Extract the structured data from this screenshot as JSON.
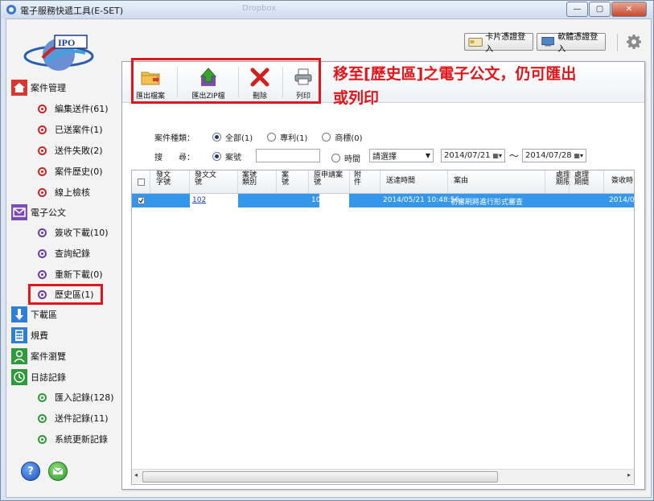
{
  "window": {
    "title": "電子服務快遞工具(E-SET)",
    "background_title": "Dropbox",
    "buttons": {
      "minimize": "—",
      "maximize": "▢",
      "close": "✕"
    }
  },
  "header": {
    "card_login": "卡片憑證登入",
    "software_login": "軟體憑證登入",
    "settings_icon": "gear-icon"
  },
  "sidebar": {
    "case_mgmt": {
      "label": "案件管理",
      "items": [
        "編集送件(61)",
        "已送案件(1)",
        "送件失敗(2)",
        "案件歷史(0)",
        "線上檢核"
      ]
    },
    "e_doc": {
      "label": "電子公文",
      "items": [
        "簽收下載(10)",
        "查詢紀錄",
        "重新下載(0)",
        "歷史區(1)"
      ]
    },
    "download": "下載區",
    "fees": "規費",
    "case_browse": "案件瀏覽",
    "log": {
      "label": "日誌記錄",
      "items": [
        "匯入記錄(128)",
        "送件記錄(11)",
        "系統更新記錄"
      ]
    }
  },
  "toolbar": {
    "export_file": "匯出檔案",
    "export_zip": "匯出ZIP檔",
    "delete": "刪除",
    "print": "列印"
  },
  "annotation": {
    "line1": "移至[歷史區]之電子公文，仍可匯出",
    "line2": "或列印"
  },
  "filters": {
    "case_type_label": "案件種類：",
    "all": "全部(1)",
    "patent": "專利(1)",
    "trademark": "商標(0)",
    "search_label": "搜　　尋：",
    "case_no": "案號",
    "time": "時間",
    "select_placeholder": "請選擇",
    "date_from": "2014/07/21",
    "tilde": "～",
    "date_to": "2014/07/28"
  },
  "grid": {
    "columns": [
      "發文\n字號",
      "發文文\n號",
      "案號\n類別",
      "案\n號",
      "原申請案\n號",
      "附\n件",
      "送達時間",
      "案由",
      "處理\n期限",
      "處理\n期間",
      "簽收時"
    ],
    "rows": [
      {
        "doc_no": "102",
        "orig": "10",
        "delivered": "2014/05/21 10:48:56",
        "reason": "初審刷將進行形式審查",
        "signed": "2014/0"
      }
    ]
  },
  "colors": {
    "accent_red": "#e0161b",
    "selection": "#3597e9"
  }
}
